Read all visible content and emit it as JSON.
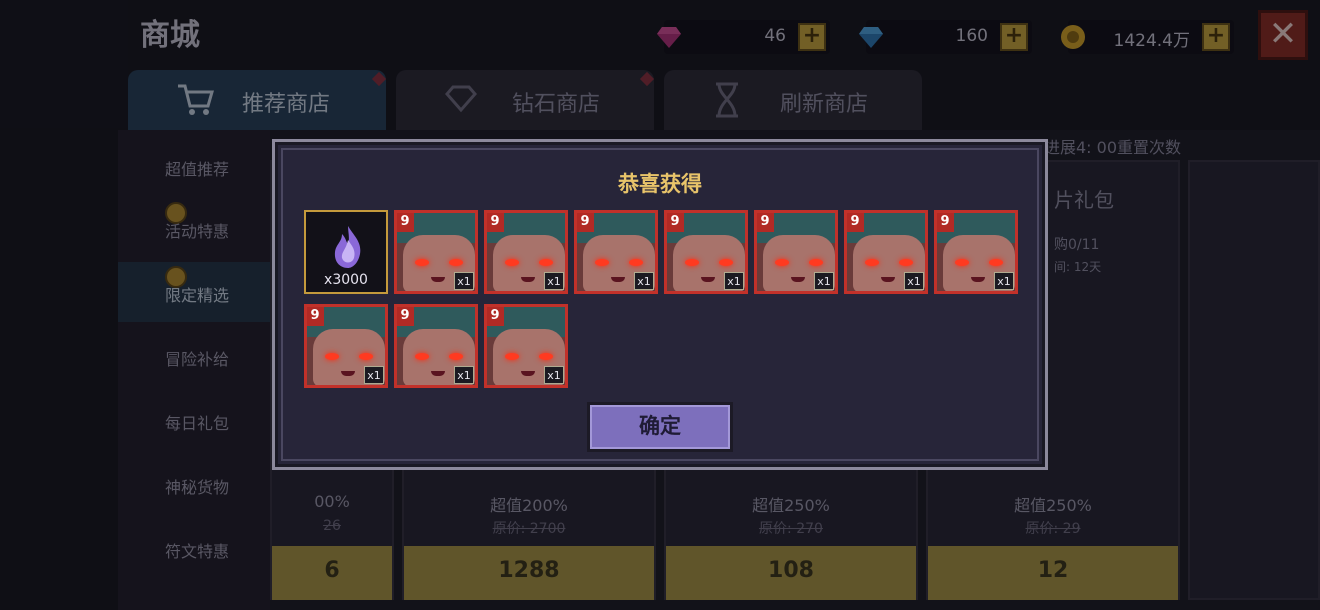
{
  "page_title": "商城",
  "resources": [
    {
      "icon": "purple-gem-icon",
      "value": "46"
    },
    {
      "icon": "blue-diamond-icon",
      "value": "160"
    },
    {
      "icon": "gold-coin-icon",
      "value": "1424.4万"
    }
  ],
  "tabs": [
    {
      "label": "推荐商店",
      "icon": "cart-icon",
      "active": true
    },
    {
      "label": "钻石商店",
      "icon": "diamond-icon",
      "active": false
    },
    {
      "label": "刷新商店",
      "icon": "hourglass-icon",
      "active": false
    }
  ],
  "sidebar": [
    {
      "label": "超值推荐"
    },
    {
      "label": "活动特惠"
    },
    {
      "label": "限定精选"
    },
    {
      "label": "冒险补给"
    },
    {
      "label": "每日礼包"
    },
    {
      "label": "神秘货物"
    },
    {
      "label": "符文特惠"
    }
  ],
  "header_info": "进展4: 00重置次数",
  "card_partial": {
    "title": "片礼包",
    "limit": "购0/11",
    "days": "间: 12天"
  },
  "cards": [
    {
      "discount": "00%",
      "original": "26",
      "price": "6"
    },
    {
      "discount": "超值200%",
      "original": "原价: 2700",
      "price": "1288",
      "currency": "blue-diamond-icon"
    },
    {
      "discount": "超值250%",
      "original": "原价: 270",
      "price": "108",
      "currency": "purple-gem-icon"
    },
    {
      "discount": "超值250%",
      "original": "原价: 29",
      "price": "12",
      "currency": "purple-gem-icon"
    }
  ],
  "dialog": {
    "title": "恭喜获得",
    "crystal_qty": "x3000",
    "card_level": "9",
    "card_count": "x1",
    "confirm_label": "确定"
  },
  "colors": {
    "gold": "#e8c46a",
    "card_border": "#c2312a",
    "confirm_button": "#7d6fbc"
  }
}
